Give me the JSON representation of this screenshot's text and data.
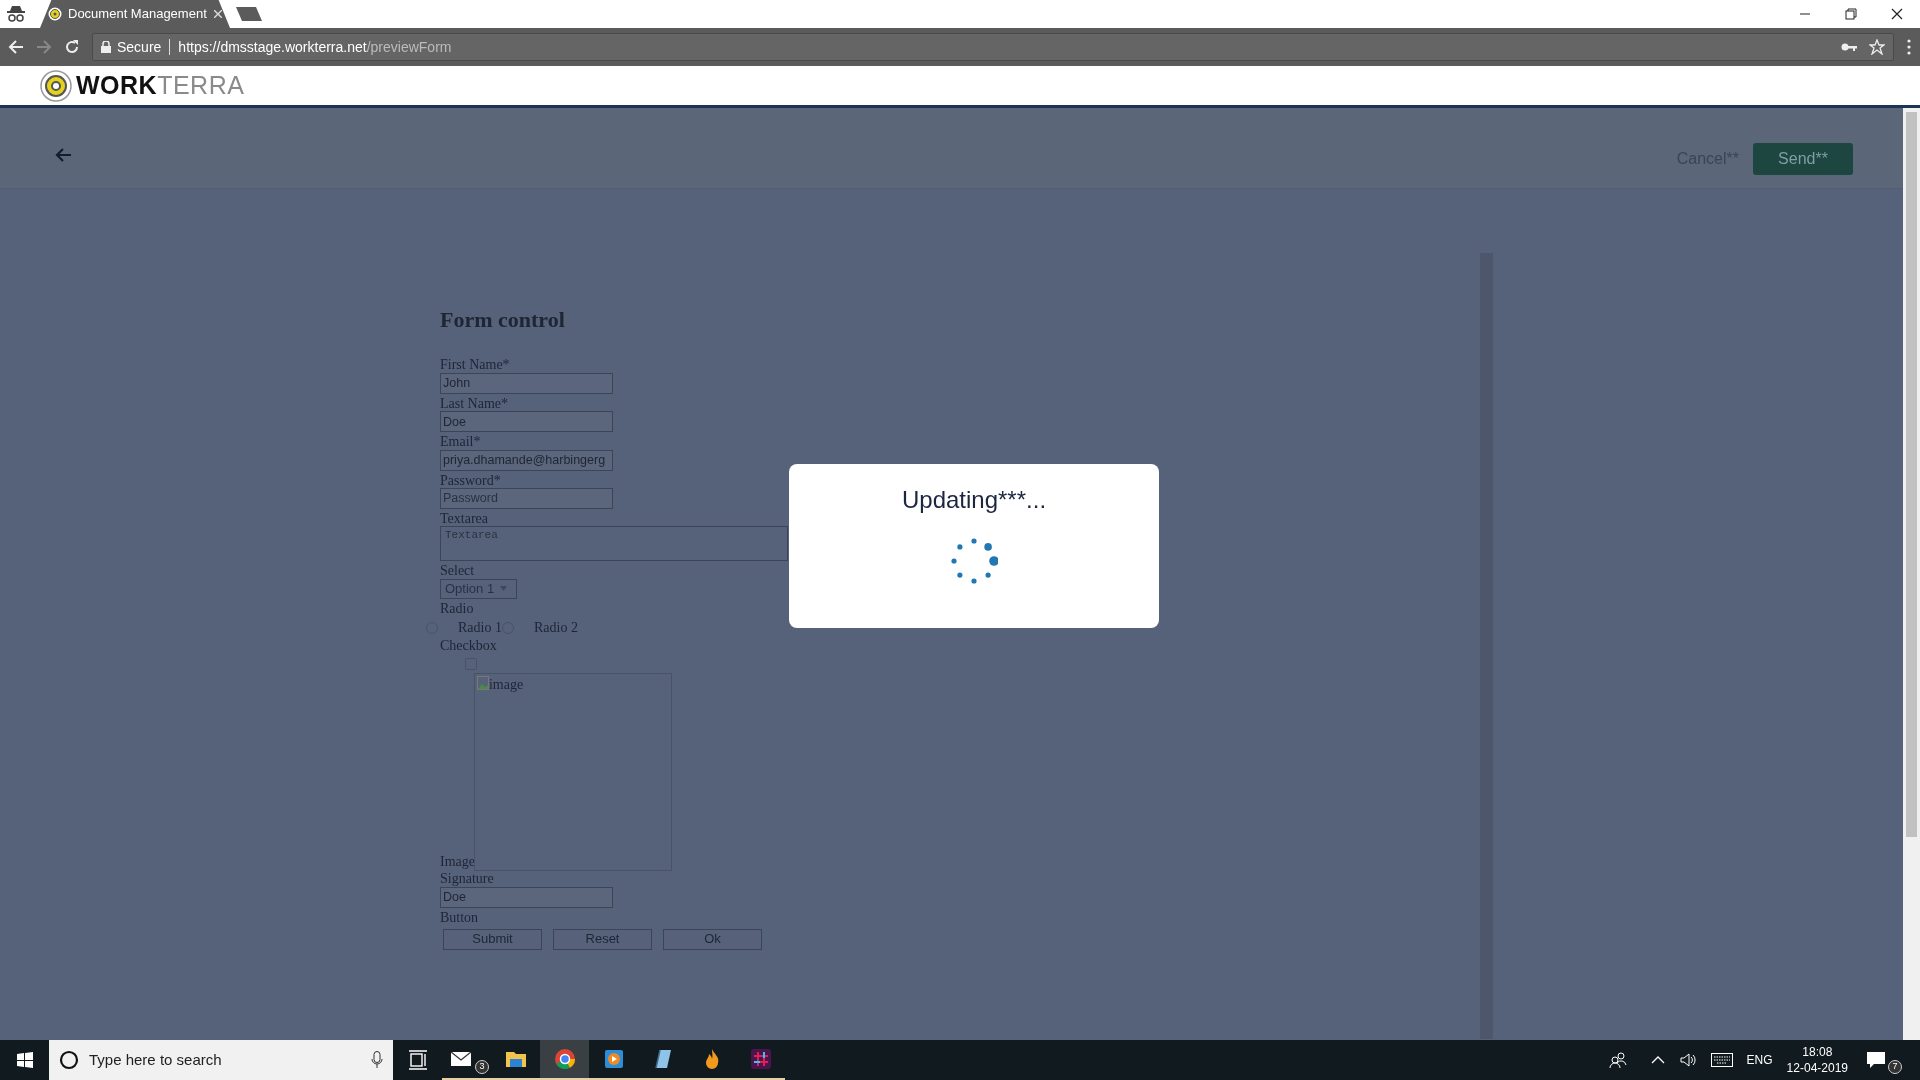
{
  "browser": {
    "tabs": [
      {
        "title": "Document Management",
        "selected": true
      }
    ],
    "security": "Secure",
    "url_host": "https://dmsstage.workterra.net",
    "url_path": "/previewForm"
  },
  "app": {
    "logo_bold": "WORK",
    "logo_light": "TERRA"
  },
  "toolbar": {
    "cancel": "Cancel**",
    "send": "Send**"
  },
  "form": {
    "title": "Form control",
    "fields": [
      {
        "kind": "text",
        "label": "First Name*",
        "value": "John"
      },
      {
        "kind": "text",
        "label": "Last Name*",
        "value": "Doe"
      },
      {
        "kind": "text",
        "label": "Email*",
        "value": "priya.dhamande@harbingerg"
      },
      {
        "kind": "text",
        "label": "Password*",
        "placeholder": "Password"
      },
      {
        "kind": "textarea",
        "label": "Textarea",
        "placeholder": "Textarea"
      },
      {
        "kind": "select",
        "label": "Select",
        "value": "Option 1"
      },
      {
        "kind": "radio",
        "label": "Radio",
        "options": [
          {
            "label": "Radio 1",
            "selected": false
          },
          {
            "label": "Radio 2",
            "selected": false
          }
        ]
      },
      {
        "kind": "checkbox",
        "label": "Checkbox",
        "checked": false
      },
      {
        "kind": "image",
        "label": "Image",
        "alt": "image"
      },
      {
        "kind": "text",
        "label": "Signature",
        "value": "Doe"
      },
      {
        "kind": "buttons",
        "label": "Button",
        "buttons": [
          "Submit",
          "Reset",
          "Ok"
        ]
      }
    ]
  },
  "modal": {
    "title": "Updating***..."
  },
  "taskbar": {
    "search_placeholder": "Type here to search",
    "mail_badge": "3",
    "language": "ENG",
    "time": "18:08",
    "date": "12-04-2019",
    "notification_badge": "7"
  }
}
